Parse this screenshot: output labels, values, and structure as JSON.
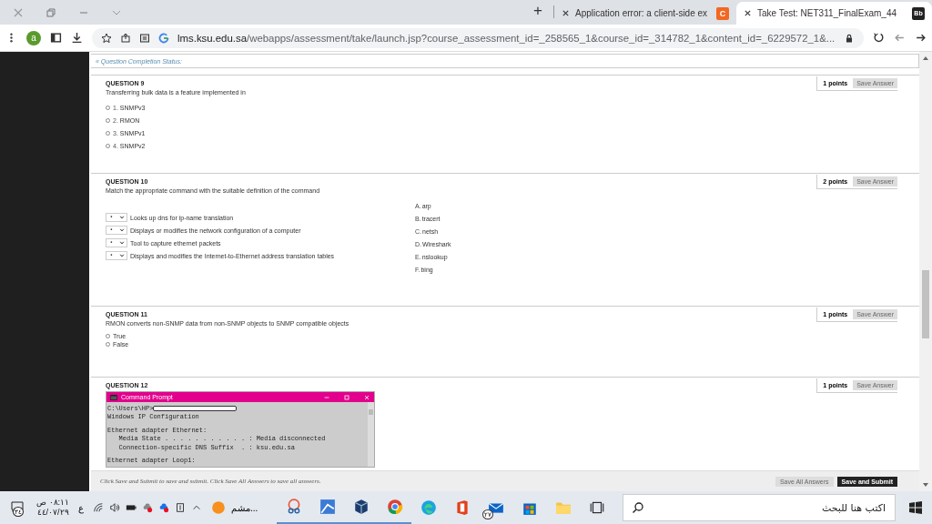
{
  "browser": {
    "tabs": [
      {
        "title": "Application error: a client-side ex",
        "favicon": "C",
        "selected": false
      },
      {
        "title": "Take Test: NET311_FinalExam_44",
        "favicon": "Bb",
        "selected": true
      }
    ],
    "new_tab": "+",
    "profile": "a",
    "url_host": "lms.ksu.edu.sa",
    "url_path": "/webapps/assessment/take/launch.jsp?course_assessment_id=_258565_1&course_id=_314782_1&content_id=_6229572_1&..."
  },
  "status_link": "« Question Completion Status:",
  "questions": [
    {
      "kind": "choice",
      "title": "QUESTION 9",
      "points": "1 points",
      "save": "Save Answer",
      "text": "Transferring bulk data is a feature implemented in",
      "options": [
        {
          "number": "1.",
          "label": "SNMPv3",
          "selected": false
        },
        {
          "number": "2.",
          "label": "RMON",
          "selected": false
        },
        {
          "number": "3.",
          "label": "SNMPv1",
          "selected": false
        },
        {
          "number": "4.",
          "label": "SNMPv2",
          "selected": false
        }
      ]
    },
    {
      "kind": "match",
      "title": "QUESTION 10",
      "points": "2 points",
      "save": "Save Answer",
      "text": "Match the appropriate command with the suitable definition of the command",
      "prompts": [
        {
          "value": "·",
          "text": "Looks up dns for ip-name translation"
        },
        {
          "value": "·",
          "text": "Displays or modifies the network configuration of a computer"
        },
        {
          "value": "·",
          "text": "Tool to capture ethernet packets"
        },
        {
          "value": "·",
          "text": "Displays and modifies the Internet-to-Ethernet address translation tables"
        }
      ],
      "answers": [
        {
          "letter": "A.",
          "text": "arp"
        },
        {
          "letter": "B.",
          "text": "tracert"
        },
        {
          "letter": "C.",
          "text": "netsh"
        },
        {
          "letter": "D.",
          "text": "Wireshark"
        },
        {
          "letter": "E.",
          "text": "nslookup"
        },
        {
          "letter": "F.",
          "text": "bing"
        }
      ]
    },
    {
      "kind": "choice",
      "title": "QUESTION 11",
      "points": "1 points",
      "save": "Save Answer",
      "text": "RMON converts non-SNMP data from non-SNMP objects to SNMP compatible objects",
      "options": [
        {
          "label": "True",
          "selected": false
        },
        {
          "label": "False",
          "selected": false
        }
      ]
    },
    {
      "kind": "image",
      "title": "QUESTION 12",
      "points": "1 points",
      "save": "Save Answer",
      "cmd": {
        "title": "Command Prompt",
        "prompt": "C:\\Users\\HP>",
        "lines": [
          "Windows IP Configuration",
          "Ethernet adapter Ethernet:",
          "   Media State . . . . . . . . . . . : Media disconnected",
          "   Connection-specific DNS Suffix  . : ksu.edu.sa",
          "Ethernet adapter Loop1:"
        ]
      }
    }
  ],
  "footer": {
    "note": "Click Save and Submit to save and submit. Click Save All Answers to save all answers.",
    "buttons": [
      "Save All Answers",
      "Save and Submit"
    ]
  },
  "taskbar": {
    "notification_badge": "٣٤",
    "time": "٠٨:١١ ص",
    "date": "٤٤/٠٧/٢٩",
    "language": "ع",
    "weather": "مشم...",
    "mail_badge": "٢٧",
    "search_placeholder": "اكتب هنا للبحث"
  }
}
